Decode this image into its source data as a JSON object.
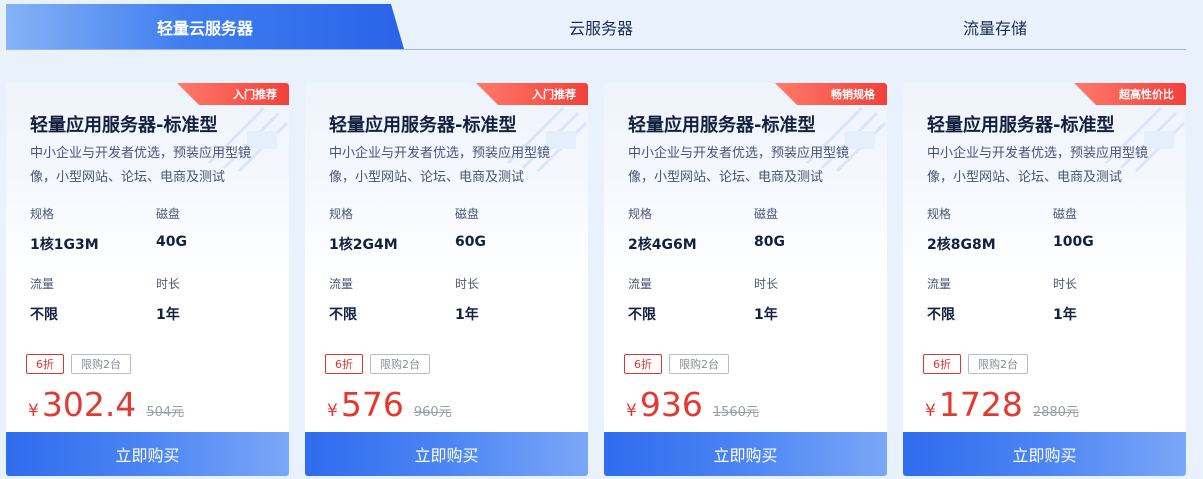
{
  "tabs": [
    {
      "label": "轻量云服务器",
      "active": true
    },
    {
      "label": "云服务器",
      "active": false
    },
    {
      "label": "流量存储",
      "active": false
    }
  ],
  "spec_labels": {
    "spec": "规格",
    "disk": "磁盘",
    "traffic": "流量",
    "duration": "时长"
  },
  "limit_tag": "限购2台",
  "currency_symbol": "¥",
  "buy_label": "立即购买",
  "cards": [
    {
      "badge": "入门推荐",
      "title": "轻量应用服务器-标准型",
      "desc": "中小企业与开发者优选，预装应用型镜像，小型网站、论坛、电商及测试",
      "spec": "1核1G3M",
      "disk": "40G",
      "traffic": "不限",
      "duration": "1年",
      "discount": "6折",
      "price": "302.4",
      "original_price": "504元"
    },
    {
      "badge": "入门推荐",
      "title": "轻量应用服务器-标准型",
      "desc": "中小企业与开发者优选，预装应用型镜像，小型网站、论坛、电商及测试",
      "spec": "1核2G4M",
      "disk": "60G",
      "traffic": "不限",
      "duration": "1年",
      "discount": "6折",
      "price": "576",
      "original_price": "960元"
    },
    {
      "badge": "畅销规格",
      "title": "轻量应用服务器-标准型",
      "desc": "中小企业与开发者优选，预装应用型镜像，小型网站、论坛、电商及测试",
      "spec": "2核4G6M",
      "disk": "80G",
      "traffic": "不限",
      "duration": "1年",
      "discount": "6折",
      "price": "936",
      "original_price": "1560元"
    },
    {
      "badge": "超高性价比",
      "title": "轻量应用服务器-标准型",
      "desc": "中小企业与开发者优选，预装应用型镜像，小型网站、论坛、电商及测试",
      "spec": "2核8G8M",
      "disk": "100G",
      "traffic": "不限",
      "duration": "1年",
      "discount": "6折",
      "price": "1728",
      "original_price": "2880元"
    }
  ],
  "colors": {
    "accent": "#2f6cee",
    "price": "#e23a31",
    "badge": "#f2403a",
    "background": "#e9f1fc"
  }
}
